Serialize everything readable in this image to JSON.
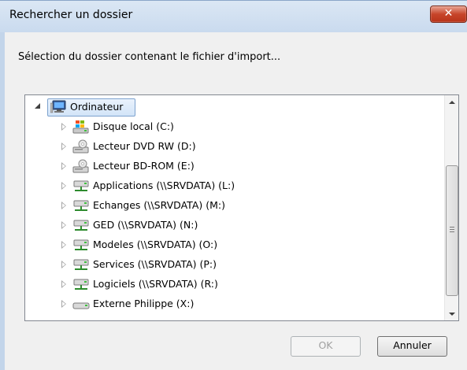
{
  "window": {
    "title": "Rechercher un dossier",
    "close_glyph": "✕"
  },
  "description": "Sélection du dossier contenant le fichier d'import...",
  "tree": {
    "root": {
      "label": "Ordinateur",
      "icon": "computer-icon",
      "expanded": true,
      "selected": true
    },
    "items": [
      {
        "label": "Disque local (C:)",
        "icon": "windows-drive-icon"
      },
      {
        "label": "Lecteur DVD RW (D:)",
        "icon": "optical-drive-icon"
      },
      {
        "label": "Lecteur BD-ROM (E:)",
        "icon": "optical-drive-icon"
      },
      {
        "label": "Applications (\\\\SRVDATA) (L:)",
        "icon": "network-drive-icon"
      },
      {
        "label": "Echanges (\\\\SRVDATA) (M:)",
        "icon": "network-drive-icon"
      },
      {
        "label": "GED (\\\\SRVDATA) (N:)",
        "icon": "network-drive-icon"
      },
      {
        "label": "Modeles (\\\\SRVDATA) (O:)",
        "icon": "network-drive-icon"
      },
      {
        "label": "Services (\\\\SRVDATA) (P:)",
        "icon": "network-drive-icon"
      },
      {
        "label": "Logiciels (\\\\SRVDATA) (R:)",
        "icon": "network-drive-icon"
      },
      {
        "label": "Externe Philippe (X:)",
        "icon": "removable-drive-icon"
      }
    ]
  },
  "buttons": {
    "ok": "OK",
    "cancel": "Annuler"
  },
  "colors": {
    "selection_border": "#7da2ce",
    "close_button": "#c7452a"
  }
}
